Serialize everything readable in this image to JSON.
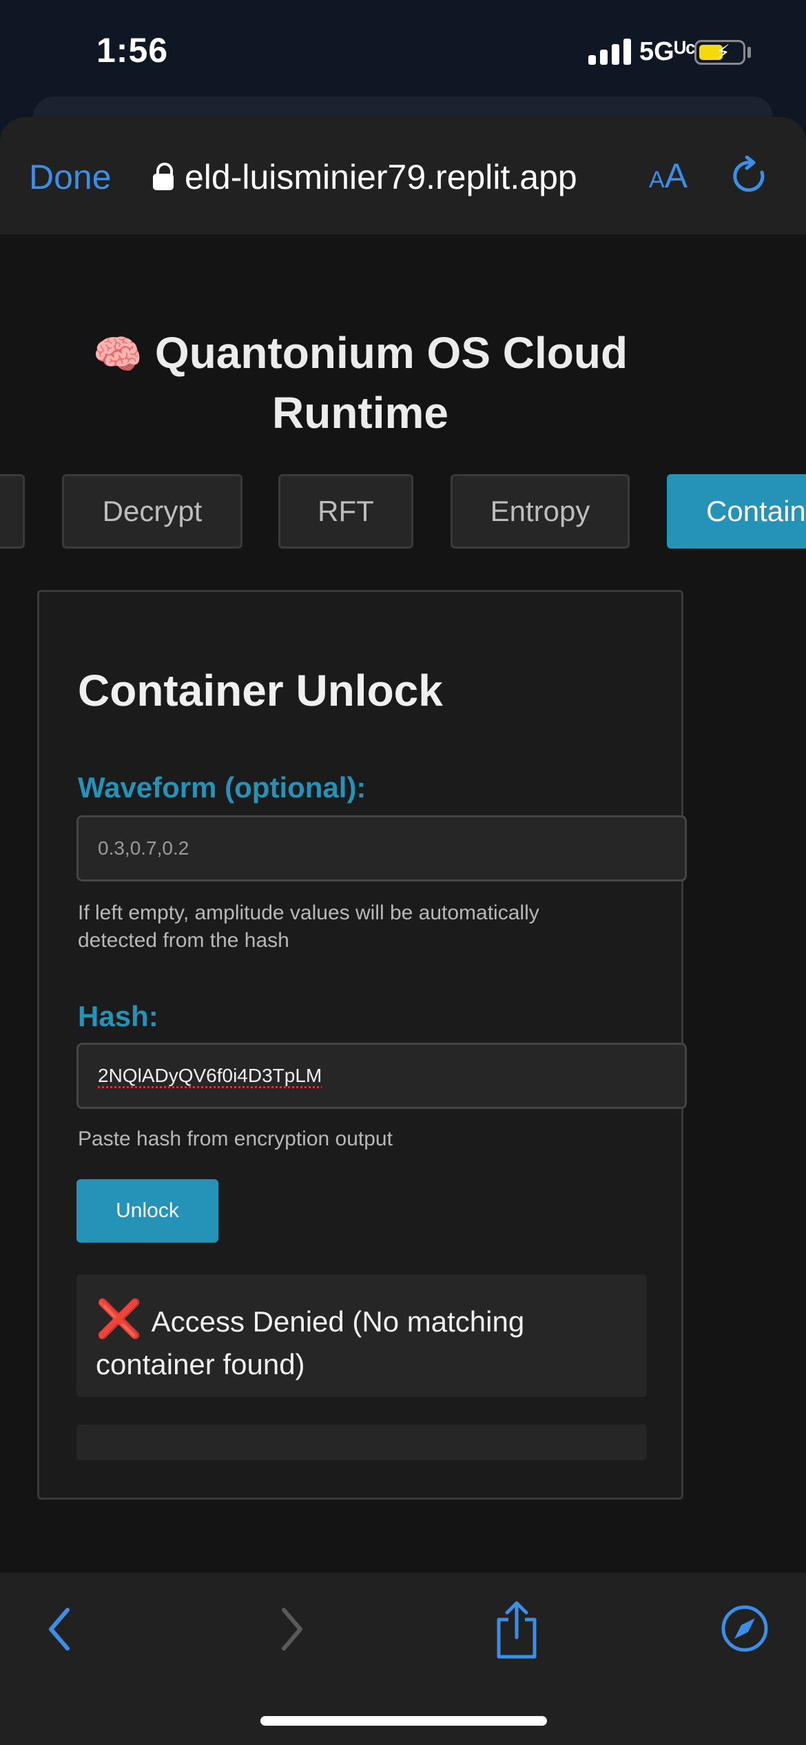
{
  "status_bar": {
    "time": "1:56",
    "network": "5Gᵁᶜ"
  },
  "browser": {
    "done_label": "Done",
    "url": "eld-luisminier79.replit.app",
    "aa_small": "A",
    "aa_big": "A"
  },
  "page": {
    "title": "Quantonium OS Cloud Runtime",
    "title_icon": "🧠",
    "tabs": [
      {
        "label": "",
        "active": false
      },
      {
        "label": "Decrypt",
        "active": false
      },
      {
        "label": "RFT",
        "active": false
      },
      {
        "label": "Entropy",
        "active": false
      },
      {
        "label": "Contain",
        "active": true
      }
    ],
    "card": {
      "title": "Container Unlock",
      "waveform_label": "Waveform (optional):",
      "waveform_placeholder": "0.3,0.7,0.2",
      "waveform_hint": "If left empty, amplitude values will be automatically detected from the hash",
      "hash_label": "Hash:",
      "hash_value": "2NQlADyQV6f0i4D3TpLM",
      "hash_hint": "Paste hash from encryption output",
      "unlock_label": "Unlock",
      "result_icon": "❌",
      "result_text": "Access Denied (No matching container found)"
    }
  },
  "colors": {
    "accent": "#2593b8",
    "link": "#3b8fe8",
    "error": "#e3212b"
  }
}
